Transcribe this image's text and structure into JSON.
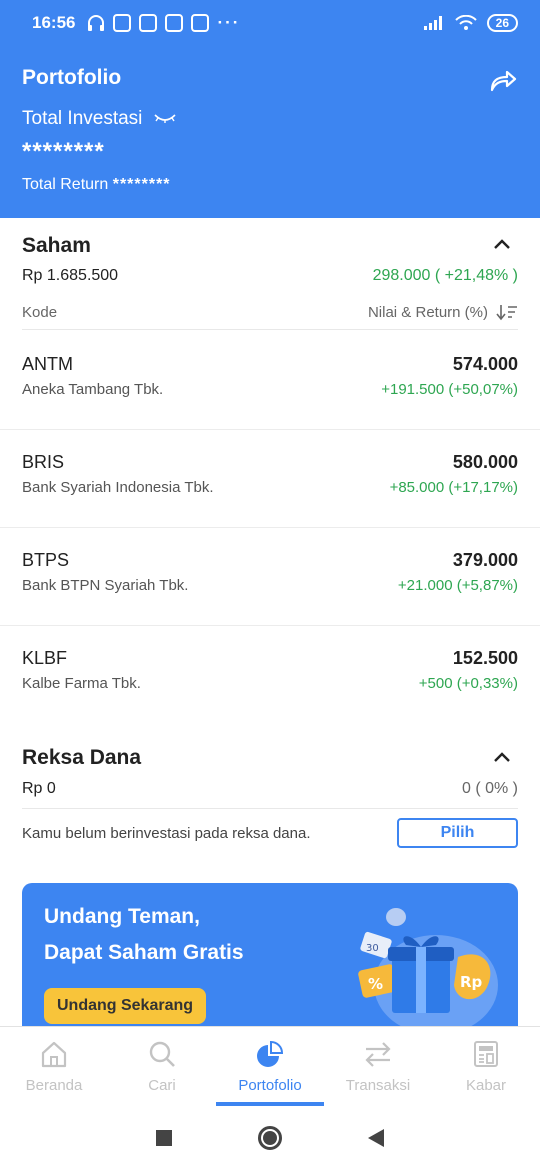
{
  "status_bar": {
    "time": "16:56",
    "battery": "26"
  },
  "header": {
    "title": "Portofolio",
    "total_label": "Total Investasi",
    "total_value": "********",
    "return_label": "Total Return",
    "return_value": "********"
  },
  "saham": {
    "title": "Saham",
    "total": "Rp 1.685.500",
    "gain": "298.000 ( +21,48% )",
    "col_code": "Kode",
    "col_value": "Nilai & Return (%)",
    "stocks": [
      {
        "code": "ANTM",
        "name": "Aneka Tambang Tbk.",
        "value": "574.000",
        "change": "+191.500 (+50,07%)"
      },
      {
        "code": "BRIS",
        "name": "Bank Syariah Indonesia Tbk.",
        "value": "580.000",
        "change": "+85.000 (+17,17%)"
      },
      {
        "code": "BTPS",
        "name": "Bank BTPN Syariah Tbk.",
        "value": "379.000",
        "change": "+21.000 (+5,87%)"
      },
      {
        "code": "KLBF",
        "name": "Kalbe Farma Tbk.",
        "value": "152.500",
        "change": "+500 (+0,33%)"
      }
    ]
  },
  "reksa_dana": {
    "title": "Reksa Dana",
    "total": "Rp 0",
    "gain": "0 ( 0% )",
    "empty_text": "Kamu belum berinvestasi pada reksa dana.",
    "button": "Pilih"
  },
  "banner": {
    "line1": "Undang Teman,",
    "line2": "Dapat Saham Gratis",
    "cta": "Undang Sekarang",
    "art_coupon": "30",
    "art_percent": "%",
    "art_rp": "Rp"
  },
  "tabs": [
    {
      "label": "Beranda",
      "icon": "home-icon"
    },
    {
      "label": "Cari",
      "icon": "search-icon"
    },
    {
      "label": "Portofolio",
      "icon": "pie-chart-icon"
    },
    {
      "label": "Transaksi",
      "icon": "transfer-icon"
    },
    {
      "label": "Kabar",
      "icon": "news-icon"
    }
  ],
  "colors": {
    "primary": "#3d85f1",
    "positive": "#2ea651",
    "cta": "#f8c43a"
  }
}
